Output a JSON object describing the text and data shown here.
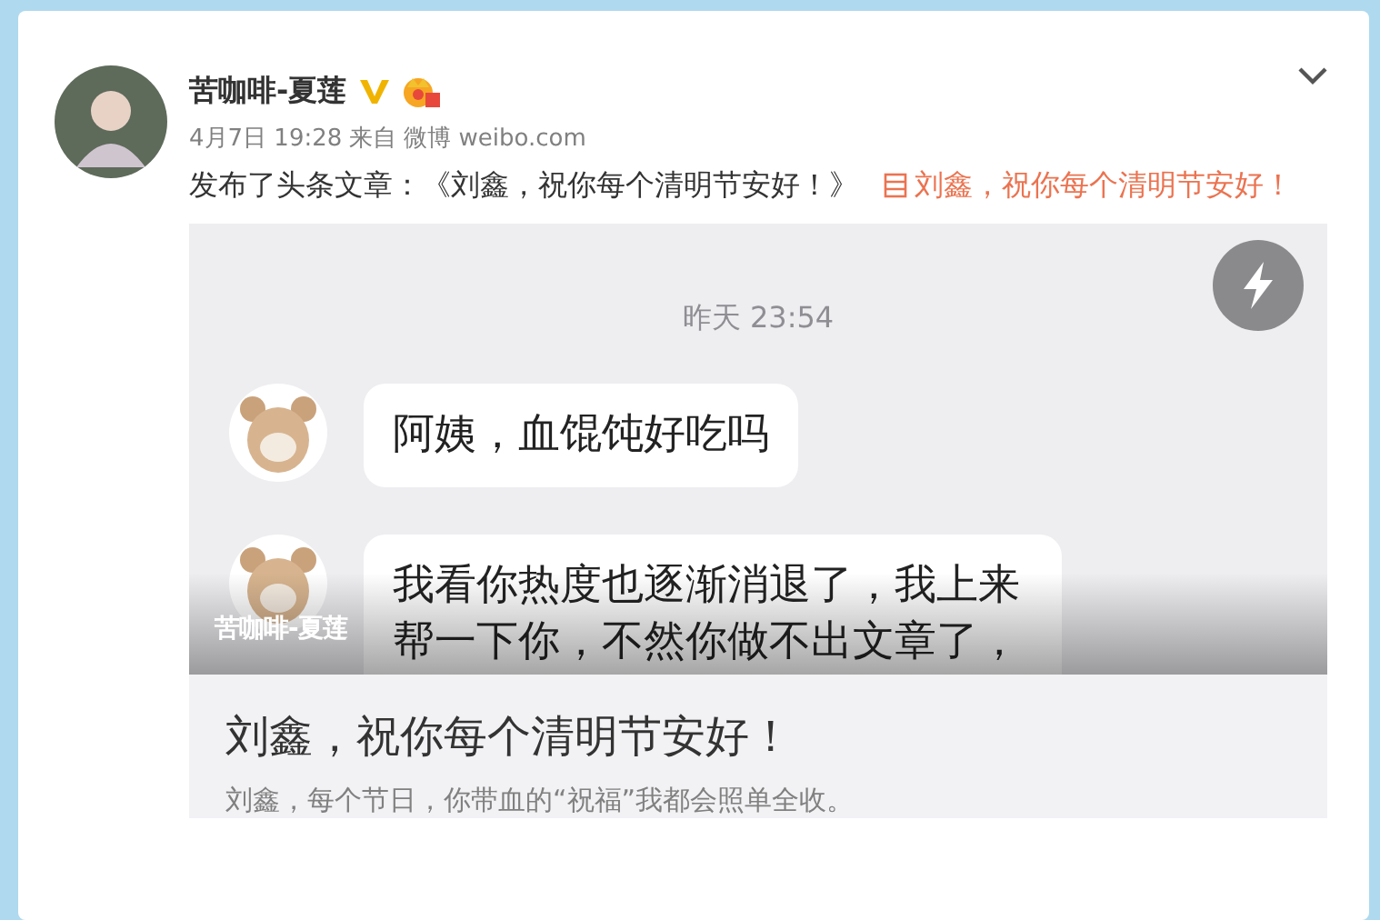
{
  "post": {
    "author": "苦咖啡-夏莲",
    "verified": true,
    "vip": true,
    "time": "4月7日 19:28",
    "source_prefix": "来自",
    "source": "微博 weibo.com",
    "text": "发布了头条文章：《刘鑫，祝你每个清明节安好！》",
    "link": "刘鑫，祝你每个清明节安好！"
  },
  "article": {
    "cover": {
      "time": "昨天 23:54",
      "messages": [
        {
          "text": "阿姨，血馄饨好吃吗"
        },
        {
          "text": "我看你热度也逐渐消退了，我上来帮一下你，不然你做不出文章了，"
        }
      ],
      "caption": "苦咖啡-夏莲"
    },
    "title": "刘鑫，祝你每个清明节安好！",
    "summary": "刘鑫，每个节日，你带血的“祝福”我都会照单全收。"
  }
}
